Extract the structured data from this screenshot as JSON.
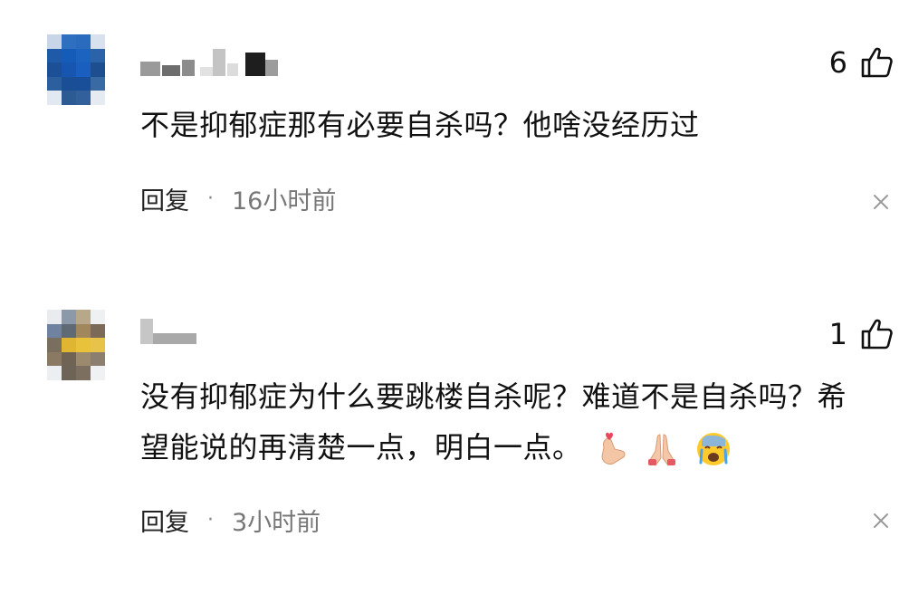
{
  "comments": [
    {
      "likes": "6",
      "text": "不是抑郁症那有必要自杀吗？他啥没经历过",
      "reply_label": "回复",
      "separator": "·",
      "time": "16小时前",
      "icons": {
        "like": "thumbs-up-icon",
        "close": "close-icon"
      }
    },
    {
      "likes": "1",
      "text_line1": "没有抑郁症为什么要跳楼自杀呢？难道不是自杀吗？希",
      "text_line2": "望能说的再清楚一点，明白一点。",
      "emojis": [
        "finger-heart-emoji",
        "folded-hands-emoji",
        "crying-face-emoji"
      ],
      "reply_label": "回复",
      "separator": "·",
      "time": "3小时前",
      "icons": {
        "like": "thumbs-up-icon",
        "close": "close-icon"
      }
    }
  ]
}
